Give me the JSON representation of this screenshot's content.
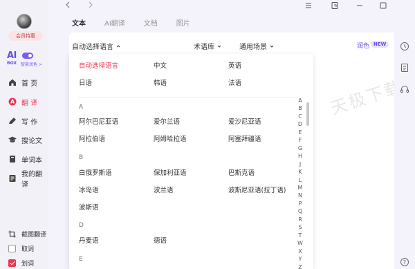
{
  "sidebar": {
    "vip_label": "会员特惠",
    "ai_logo": "AI",
    "box_logo": "BOX",
    "smart_label": "智能润色 >",
    "nav": [
      {
        "label": "首 页",
        "icon": "home-icon"
      },
      {
        "label": "翻 译",
        "icon": "translate-icon"
      },
      {
        "label": "写 作",
        "icon": "write-icon"
      },
      {
        "label": "搜论文",
        "icon": "graduation-cap-icon"
      },
      {
        "label": "单词本",
        "icon": "wordbook-icon"
      },
      {
        "label": "我的翻译",
        "icon": "my-translation-icon"
      }
    ],
    "screenshot_translate": "截图翻译",
    "pick_word": "取词",
    "select_word": "划词"
  },
  "tabs": [
    {
      "label": "文本"
    },
    {
      "label": "AI翻译"
    },
    {
      "label": "文档"
    },
    {
      "label": "图片"
    }
  ],
  "lang_bar": {
    "source_lang": "自动选择语言",
    "glossary": "术语库",
    "scene": "通用场景",
    "polish": "润色",
    "new_badge": "NEW"
  },
  "dropdown": {
    "top_langs": [
      "自动选择语言",
      "中文",
      "英语",
      "日语",
      "韩语",
      "法语"
    ],
    "groups": [
      {
        "letter": "A",
        "langs": [
          "阿尔巴尼亚语",
          "爱尔兰语",
          "爱沙尼亚语",
          "阿拉伯语",
          "阿姆哈拉语",
          "阿塞拜疆语"
        ]
      },
      {
        "letter": "B",
        "langs": [
          "白俄罗斯语",
          "保加利亚语",
          "巴斯克语",
          "冰岛语",
          "波兰语",
          "波斯尼亚语(拉丁语)",
          "波斯语"
        ]
      },
      {
        "letter": "D",
        "langs": [
          "丹麦语",
          "德语"
        ]
      },
      {
        "letter": "E",
        "langs": []
      }
    ],
    "alphabet": [
      "A",
      "B",
      "C",
      "D",
      "E",
      "F",
      "G",
      "H",
      "J",
      "K",
      "L",
      "M",
      "N",
      "P",
      "Q",
      "R",
      "S",
      "T",
      "W",
      "X",
      "Y",
      "Z"
    ]
  },
  "watermark": "天极下载站",
  "colors": {
    "accent_red": "#e8384f",
    "accent_purple": "#6a4ee8"
  }
}
